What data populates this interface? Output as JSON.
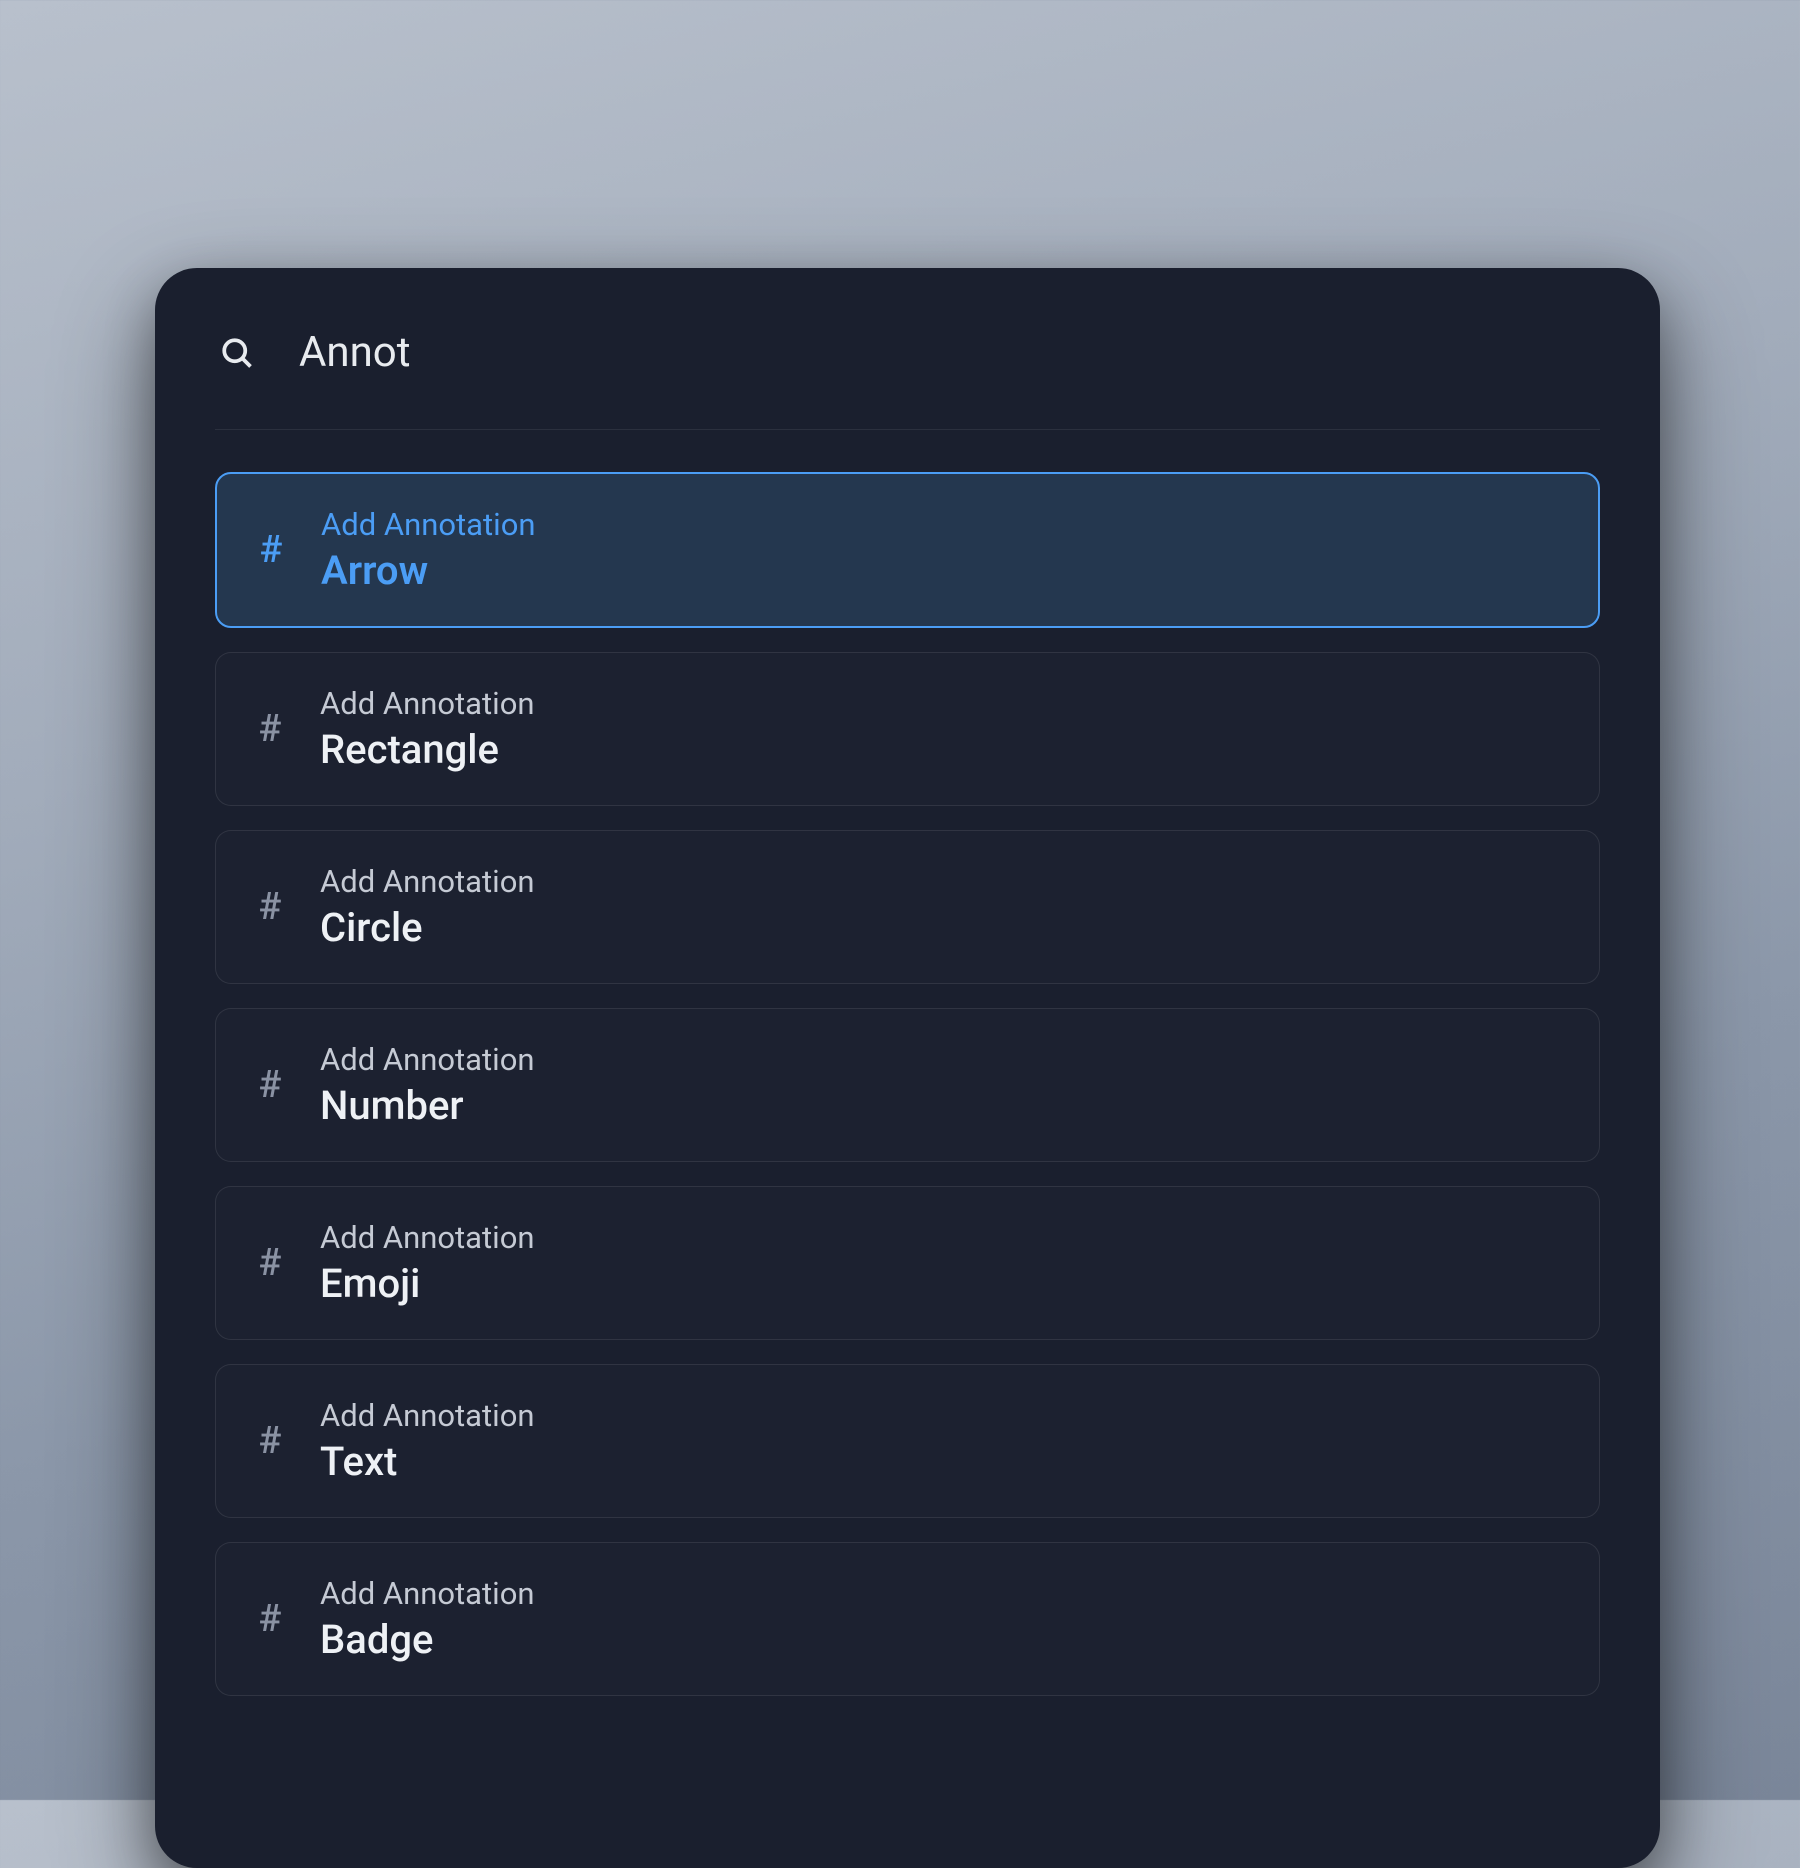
{
  "search": {
    "value": "Annot",
    "placeholder": ""
  },
  "results": [
    {
      "category": "Add Annotation",
      "name": "Arrow",
      "selected": true
    },
    {
      "category": "Add Annotation",
      "name": "Rectangle",
      "selected": false
    },
    {
      "category": "Add Annotation",
      "name": "Circle",
      "selected": false
    },
    {
      "category": "Add Annotation",
      "name": "Number",
      "selected": false
    },
    {
      "category": "Add Annotation",
      "name": "Emoji",
      "selected": false
    },
    {
      "category": "Add Annotation",
      "name": "Text",
      "selected": false
    },
    {
      "category": "Add Annotation",
      "name": "Badge",
      "selected": false
    }
  ],
  "icons": {
    "hash": "#"
  },
  "colors": {
    "panel_bg": "#1a1f2e",
    "accent": "#4b9df5",
    "selected_bg": "#24374f",
    "text_primary": "#eef1f5",
    "text_secondary": "#c5cad4",
    "text_muted": "#8a92a3"
  }
}
